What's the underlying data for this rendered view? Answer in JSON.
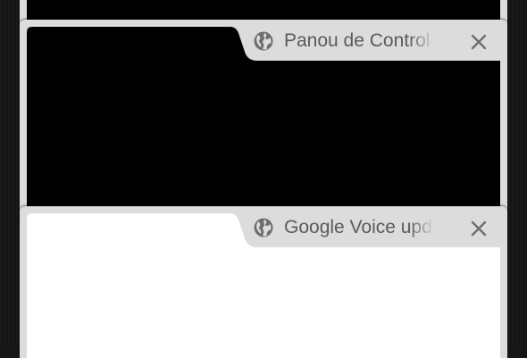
{
  "tabs": [
    {
      "title": "Panou de Control",
      "close_label": "×"
    },
    {
      "title": "Google Voice update",
      "close_label": "×"
    }
  ],
  "colors": {
    "card_frame": "#dcdcdc",
    "tab_text": "#5b5b5b",
    "icon": "#6e6e6e",
    "thumbnail_dark": "#000000",
    "thumbnail_light": "#ffffff"
  }
}
